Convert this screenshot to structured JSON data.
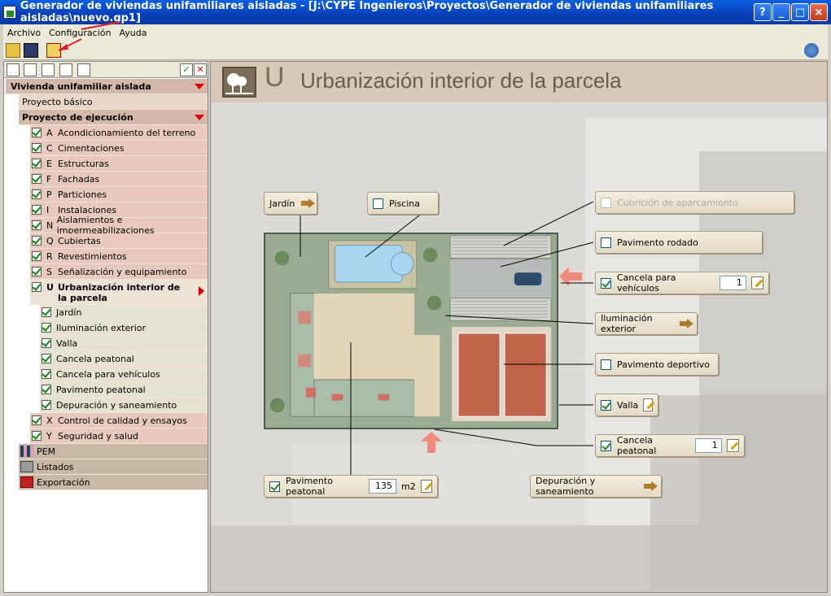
{
  "window": {
    "title": "Generador de viviendas unifamiliares aisladas - [J:\\CYPE Ingenieros\\Proyectos\\Generador de viviendas unifamiliares aisladas\\nuevo.gp1]",
    "controls": [
      "?",
      "_",
      "□",
      "×"
    ]
  },
  "menu": [
    "Archivo",
    "Configuración",
    "Ayuda"
  ],
  "toolbar_icons": [
    "open-folder-icon",
    "save-icon",
    "export-icon",
    "globe-icon"
  ],
  "tree": {
    "root": "Vivienda unifamiliar aislada",
    "basic": "Proyecto básico",
    "execution": "Proyecto de ejecución",
    "chapters": [
      {
        "code": "A",
        "label": "Acondicionamiento del terreno"
      },
      {
        "code": "C",
        "label": "Cimentaciones"
      },
      {
        "code": "E",
        "label": "Estructuras"
      },
      {
        "code": "F",
        "label": "Fachadas"
      },
      {
        "code": "P",
        "label": "Particiones"
      },
      {
        "code": "I",
        "label": "Instalaciones"
      },
      {
        "code": "N",
        "label": "Aislamientos e impermeabilizaciones"
      },
      {
        "code": "Q",
        "label": "Cubiertas"
      },
      {
        "code": "R",
        "label": "Revestimientos"
      },
      {
        "code": "S",
        "label": "Señalización y equipamiento"
      }
    ],
    "selected": {
      "code": "U",
      "label": "Urbanización interior de la parcela"
    },
    "sub_items": [
      "Jardín",
      "Iluminación exterior",
      "Valla",
      "Cancela peatonal",
      "Cancela para vehículos",
      "Pavimento peatonal",
      "Depuración y saneamiento"
    ],
    "after": [
      {
        "code": "X",
        "label": "Control de calidad y ensayos"
      },
      {
        "code": "Y",
        "label": "Seguridad y salud"
      }
    ],
    "bottom": [
      "PEM",
      "Listados",
      "Exportación"
    ]
  },
  "header": {
    "letter": "U",
    "title": "Urbanización interior de la parcela"
  },
  "items": {
    "jardin": "Jardín",
    "piscina": "Piscina",
    "cubricion": "Cubrición de aparcamiento",
    "pavimento_rodado": "Pavimento rodado",
    "cancela_vehiculos": "Cancela para vehículos",
    "cancela_vehiculos_value": "1",
    "iluminacion": "Iluminación exterior",
    "pavimento_deportivo": "Pavimento deportivo",
    "valla": "Valla",
    "cancela_peatonal": "Cancela peatonal",
    "cancela_peatonal_value": "1",
    "pavimento_peatonal": "Pavimento peatonal",
    "pavimento_peatonal_value": "135",
    "pavimento_peatonal_unit": "m2",
    "depuracion": "Depuración y saneamiento"
  }
}
